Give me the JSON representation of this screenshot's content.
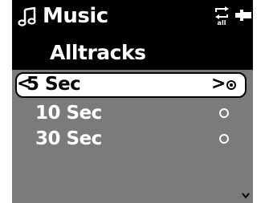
{
  "status_bar": {
    "title": "Music",
    "title_icon": "music-note-icon",
    "indicators": [
      "repeat-all-icon",
      "battery-icon"
    ],
    "repeat_icon_text": "all"
  },
  "list": {
    "title": "Alltracks",
    "items": [
      {
        "label": "5 Sec",
        "selected": true,
        "checked": true
      },
      {
        "label": "10 Sec",
        "selected": false,
        "checked": false
      },
      {
        "label": "30 Sec",
        "selected": false,
        "checked": false
      }
    ],
    "nav_left_glyph": "<",
    "nav_right_glyph": ">"
  },
  "colors": {
    "screen_background": "#000000",
    "list_background": "#7b7b7b",
    "selection_background": "#ffffff",
    "text_primary": "#ffffff",
    "text_selected": "#000000"
  }
}
